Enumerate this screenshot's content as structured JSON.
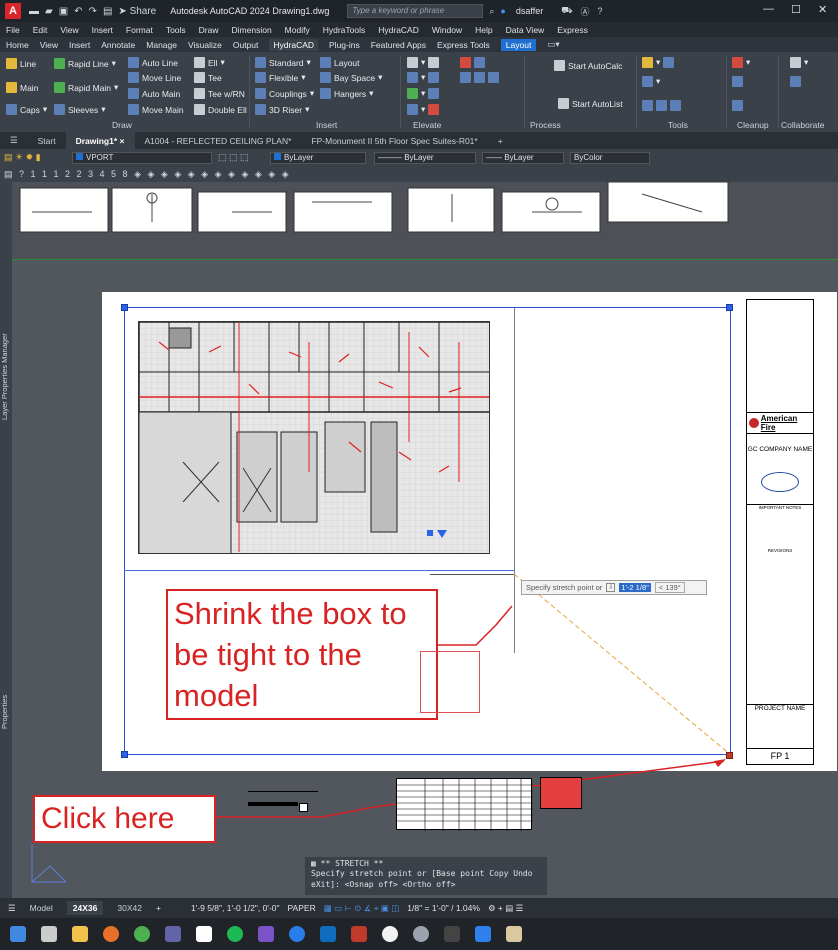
{
  "titlebar": {
    "app_logo": "A",
    "share_label": "Share",
    "title": "Autodesk AutoCAD 2024  Drawing1.dwg",
    "search_placeholder": "Type a keyword or phrase",
    "user": "dsaffer",
    "minimize": "—",
    "maximize": "☐",
    "close": "✕"
  },
  "menubar": [
    "File",
    "Edit",
    "View",
    "Insert",
    "Format",
    "Tools",
    "Draw",
    "Dimension",
    "Modify",
    "HydraTools",
    "HydraCAD",
    "Window",
    "Help",
    "Data View",
    "Express"
  ],
  "ribbon_tabs": [
    "Home",
    "View",
    "Insert",
    "Annotate",
    "Manage",
    "Visualize",
    "Output",
    "HydraCAD",
    "Plug-ins",
    "Featured Apps",
    "Express Tools",
    "Layout"
  ],
  "ribbon": {
    "draw": {
      "items": [
        "Line",
        "Rapid Line",
        "Auto Line",
        "Ell",
        "Main",
        "Rapid Main",
        "Move Line",
        "Tee",
        "Caps",
        "Sleeves",
        "Auto Main",
        "Tee w/RN",
        "Move Main",
        "Double Ell"
      ],
      "title": "Draw"
    },
    "insert": {
      "items": [
        "Standard",
        "Layout",
        "Flexible",
        "Bay Space",
        "Couplings",
        "Hangers",
        "3D Riser"
      ],
      "title": "Insert"
    },
    "elevate": {
      "title": "Elevate"
    },
    "process": {
      "items": [
        "Start AutoCalc",
        "Start AutoList"
      ],
      "title": "Process"
    },
    "tools": {
      "title": "Tools"
    },
    "cleanup": {
      "title": "Cleanup"
    },
    "collaborate": {
      "title": "Collaborate"
    }
  },
  "filetabs": [
    "Start",
    "Drawing1*",
    "A1004 - REFLECTED CEILING PLAN*",
    "FP-Monument II 5th Floor Spec Suites-R01*"
  ],
  "props": {
    "layer": "VPORT",
    "color": "ByLayer",
    "linetype": "ByLayer",
    "lineweight": "ByLayer",
    "plotstyle": "ByColor"
  },
  "palettes": {
    "layer_props": "Layer Properties Manager",
    "properties": "Properties"
  },
  "titleblock": {
    "company": "American Fire",
    "gc": "GC COMPANY NAME",
    "notes": "IMPORTANT NOTES",
    "revisions": "REVISIONS",
    "project": "PROJECT NAME",
    "sheet": "FP 1"
  },
  "dynprompt": {
    "text": "Specify stretch point or",
    "value": "1'-2 1/8\"",
    "angle": "< 139°"
  },
  "callouts": {
    "shrink": "Shrink the box to be tight to the model",
    "click": "Click here"
  },
  "cmdline": {
    "title": "** STRETCH **",
    "prompt": "Specify stretch point or [Base point Copy Undo eXit]:  <Osnap off>  <Ortho off>"
  },
  "statusbar": {
    "tabs": [
      "Model",
      "24X36",
      "30X42"
    ],
    "coords": "1'-9 5/8\", 1'-0 1/2\", 0'-0\"",
    "space": "PAPER",
    "scale": "1/8\" = 1'-0\" / 1.04%"
  },
  "colors": {
    "accent": "#1f6fd1",
    "callout": "#d92323",
    "grip": "#2b62e8",
    "viewport_border": "#2b4fd6"
  }
}
